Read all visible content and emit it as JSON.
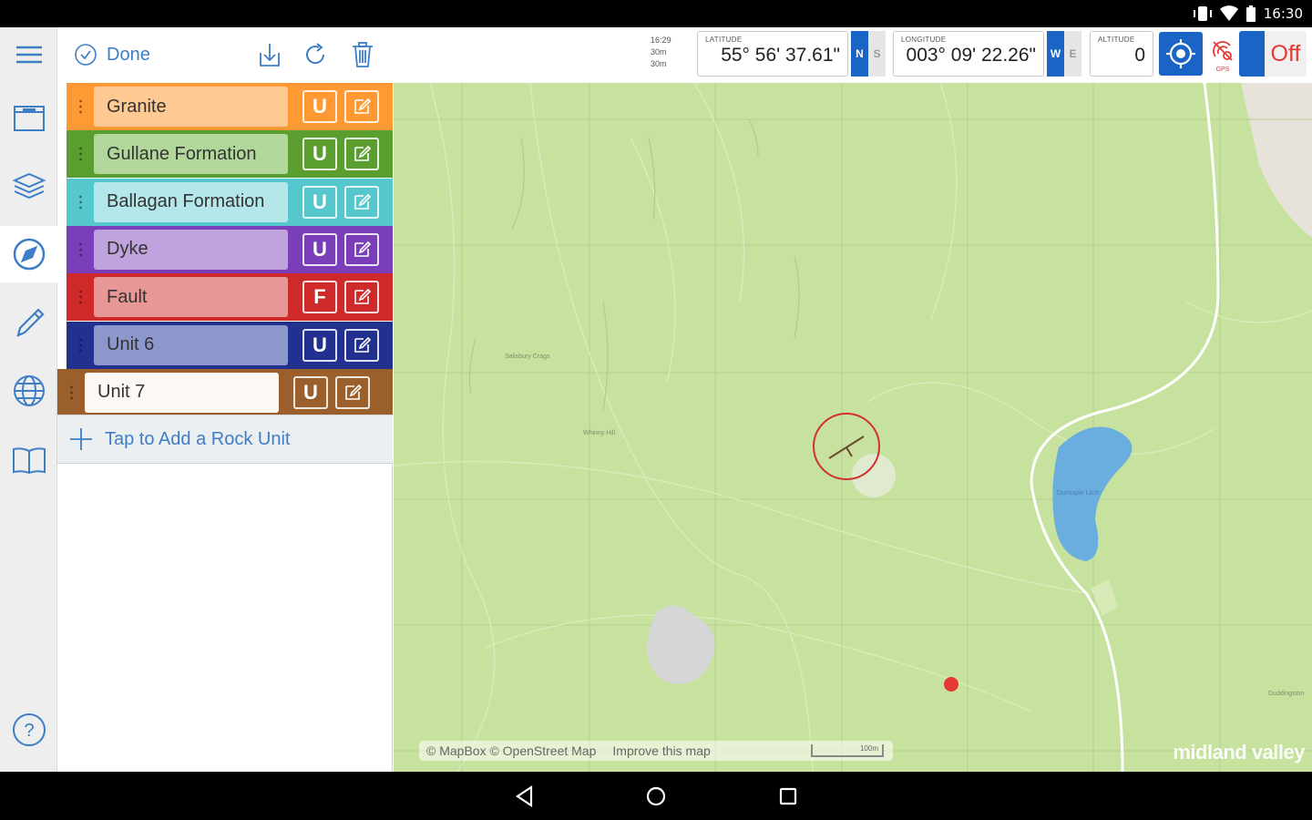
{
  "statusbar": {
    "time": "16:30",
    "icons": [
      "vibrate-icon",
      "wifi-icon",
      "battery-icon"
    ]
  },
  "rail": {
    "items": [
      {
        "name": "menu-icon"
      },
      {
        "name": "archive-icon"
      },
      {
        "name": "layers-icon"
      },
      {
        "name": "compass-icon",
        "active": true
      },
      {
        "name": "pencil-icon"
      },
      {
        "name": "globe-icon"
      },
      {
        "name": "book-icon"
      },
      {
        "name": "help-icon"
      }
    ]
  },
  "panel": {
    "done_label": "Done",
    "add_label": "Tap to Add a Rock Unit",
    "units": [
      {
        "name": "Granite",
        "type": "U",
        "color": "#ff9933",
        "fill": "#ffc994"
      },
      {
        "name": "Gullane Formation",
        "type": "U",
        "color": "#5a9e2f",
        "fill": "#b2d79a"
      },
      {
        "name": "Ballagan Formation",
        "type": "U",
        "color": "#56c7cd",
        "fill": "#b4e7ea"
      },
      {
        "name": "Dyke",
        "type": "U",
        "color": "#7a3fb8",
        "fill": "#c0a3dd"
      },
      {
        "name": "Fault",
        "type": "F",
        "color": "#cf2a2a",
        "fill": "#e89797"
      },
      {
        "name": "Unit 6",
        "type": "U",
        "color": "#22318f",
        "fill": "#8c98cc"
      },
      {
        "name": "Unit 7",
        "type": "U",
        "color": "#9a5f2a",
        "fill": "#fdf8f4",
        "selected": true
      }
    ]
  },
  "topbar": {
    "accuracy": [
      "16:29",
      "30m",
      "30m"
    ],
    "latitude_label": "LATITUDE",
    "latitude": "55° 56' 37.61\"",
    "lat_hem": [
      "N",
      "S"
    ],
    "longitude_label": "LONGITUDE",
    "longitude": "003° 09' 22.26\"",
    "lon_hem": [
      "W",
      "E"
    ],
    "altitude_label": "ALTITUDE",
    "altitude": "0",
    "gps_label": "GPS",
    "gps_toggle": "Off"
  },
  "map": {
    "labels": [
      "Salisbury Crags",
      "Whinny Hill",
      "Dunsapie Loch",
      "Duddingston"
    ],
    "attribution": "© MapBox © OpenStreet Map",
    "improve": "Improve this map",
    "scale": "100m",
    "brand": "midland valley",
    "marker_color": "#e53935",
    "land_color": "#c7e29e",
    "water_color": "#6aaee0"
  },
  "navbar": {
    "buttons": [
      "back-icon",
      "home-icon",
      "recents-icon"
    ]
  }
}
